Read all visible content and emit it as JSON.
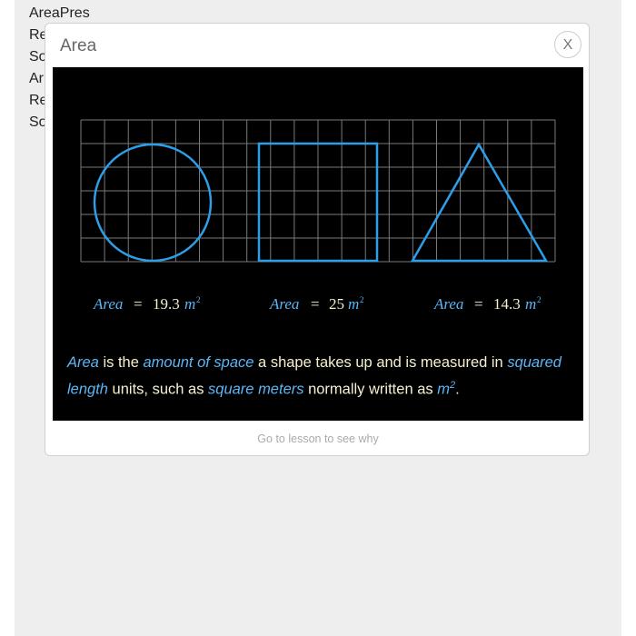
{
  "background_list": {
    "items": [
      "AreaPres",
      "Re",
      "So",
      "Ar",
      "Re",
      "So"
    ]
  },
  "dialog": {
    "title": "Area",
    "close_label": "X",
    "footer_link": "Go to lesson to see why"
  },
  "figure": {
    "shapes": [
      {
        "name": "circle",
        "word": "Area",
        "equals": "=",
        "value": "19.3",
        "unit": "m",
        "exponent": "2"
      },
      {
        "name": "square",
        "word": "Area",
        "equals": "=",
        "value": "25",
        "unit": "m",
        "exponent": "2"
      },
      {
        "name": "triangle",
        "word": "Area",
        "equals": "=",
        "value": "14.3",
        "unit": "m",
        "exponent": "2"
      }
    ],
    "colors": {
      "shape_stroke": "#2d9ee8",
      "grid": "#7a7a7a",
      "formula_word": "#5bb6f5",
      "formula_value": "#f5f0d0",
      "panel_background": "#000000"
    }
  },
  "description": {
    "term": "Area",
    "text_1": " is the ",
    "phrase_1": "amount of space",
    "text_2": " a shape takes up and is measured in ",
    "phrase_2": "squared length",
    "text_3": " units, such as ",
    "phrase_3": "square meters",
    "text_4": " normally written as ",
    "unit": "m",
    "unit_exponent": "2",
    "text_5": "."
  }
}
